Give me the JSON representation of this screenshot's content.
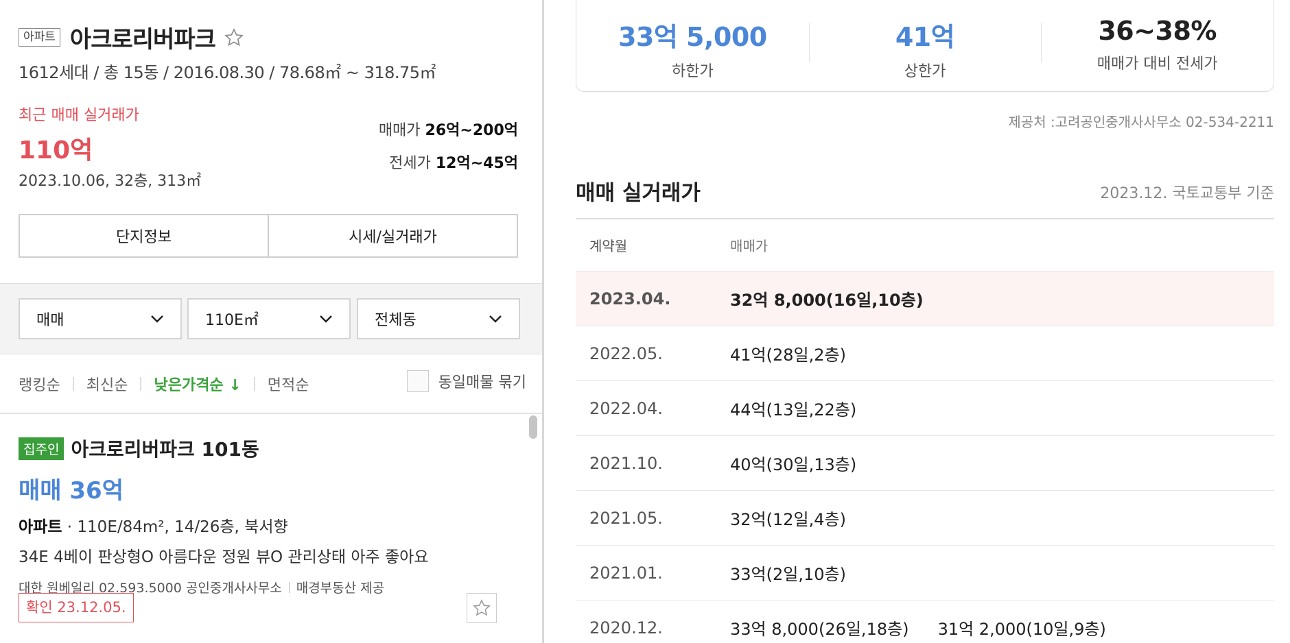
{
  "complex": {
    "type_badge": "아파트",
    "name": "아크로리버파크",
    "summary": "1612세대 / 총 15동 / 2016.08.30 / 78.68㎡ ~ 318.75㎡"
  },
  "recent": {
    "label": "최근 매매 실거래가",
    "price": "110억",
    "detail": "2023.10.06, 32층, 313㎡"
  },
  "ranges": {
    "sale_label": "매매가",
    "sale_value": "26억~200억",
    "jeonse_label": "전세가",
    "jeonse_value": "12억~45억"
  },
  "tabs": [
    "단지정보",
    "시세/실거래가"
  ],
  "filters": {
    "trade_type": "매매",
    "area": "110E㎡",
    "building": "전체동"
  },
  "sort": {
    "items": [
      "랭킹순",
      "최신순",
      "낮은가격순",
      "면적순"
    ],
    "active_arrow": "↓",
    "group_label": "동일매물 묶기"
  },
  "listing": {
    "owner_badge": "집주인",
    "name": "아크로리버파크 101동",
    "price": "매매 36억",
    "spec_type": "아파트",
    "spec_rest": " · 110E/84m², 14/26층, 북서향",
    "description": "34E 4베이 판상형O 아름다운 정원 뷰O 관리상태 아주 좋아요",
    "agency": "대한 원베일리 02.593.5000 공인중개사사무소",
    "source": "매경부동산 제공",
    "verified": "확인 23.12.05."
  },
  "stats": {
    "lower_value": "33억 5,000",
    "lower_label": "하한가",
    "upper_value": "41억",
    "upper_label": "상한가",
    "ratio_value": "36~38%",
    "ratio_label": "매매가 대비 전세가"
  },
  "provider": "제공처 :고려공인중개사사무소 02-534-2211",
  "transactions": {
    "title": "매매 실거래가",
    "note": "2023.12. 국토교통부 기준",
    "headers": [
      "계약월",
      "매매가"
    ],
    "rows": [
      {
        "month": "2023.04.",
        "prices": [
          "32억 8,000(16일,10층)"
        ]
      },
      {
        "month": "2022.05.",
        "prices": [
          "41억(28일,2층)"
        ]
      },
      {
        "month": "2022.04.",
        "prices": [
          "44억(13일,22층)"
        ]
      },
      {
        "month": "2021.10.",
        "prices": [
          "40억(30일,13층)"
        ]
      },
      {
        "month": "2021.05.",
        "prices": [
          "32억(12일,4층)"
        ]
      },
      {
        "month": "2021.01.",
        "prices": [
          "33억(2일,10층)"
        ]
      },
      {
        "month": "2020.12.",
        "prices": [
          "33억 8,000(26일,18층)",
          "31억 2,000(10일,9층)"
        ]
      }
    ]
  },
  "colors": {
    "accent_red": "#e5505a",
    "accent_blue": "#4b86d8",
    "accent_green": "#3aa23a"
  }
}
